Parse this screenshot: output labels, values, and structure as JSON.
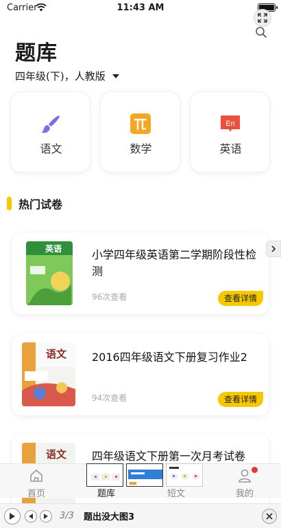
{
  "status_bar": {
    "carrier": "Carrier",
    "time": "11:43 AM"
  },
  "header": {
    "title": "题库",
    "grade_selector": "四年级(下)，人教版"
  },
  "subjects": [
    {
      "label": "语文",
      "icon": "paintbrush-icon"
    },
    {
      "label": "数学",
      "icon": "pi-icon"
    },
    {
      "label": "英语",
      "icon": "en-speech-icon"
    }
  ],
  "section": {
    "title": "热门试卷"
  },
  "papers": [
    {
      "title": "小学四年级英语第二学期阶段性检测",
      "views": "96次查看",
      "action": "查看详情",
      "cover_text": "英语"
    },
    {
      "title": "2016四年级语文下册复习作业2",
      "views": "94次查看",
      "action": "查看详情",
      "cover_text": "语文"
    },
    {
      "title": "四年级语文下册第一次月考试卷",
      "cover_text": "语文"
    }
  ],
  "tabs": [
    {
      "label": "首页",
      "icon": "home-icon"
    },
    {
      "label": "题库",
      "icon": "library-icon"
    },
    {
      "label": "短文",
      "icon": "article-icon"
    },
    {
      "label": "我的",
      "icon": "profile-icon"
    }
  ],
  "player": {
    "counter": "3/3",
    "caption": "题出没大图3"
  },
  "colors": {
    "accent": "#f7c800",
    "brush": "#7b6cf0",
    "math": "#f5a623",
    "english": "#e8513c",
    "badge": "#e53935"
  }
}
